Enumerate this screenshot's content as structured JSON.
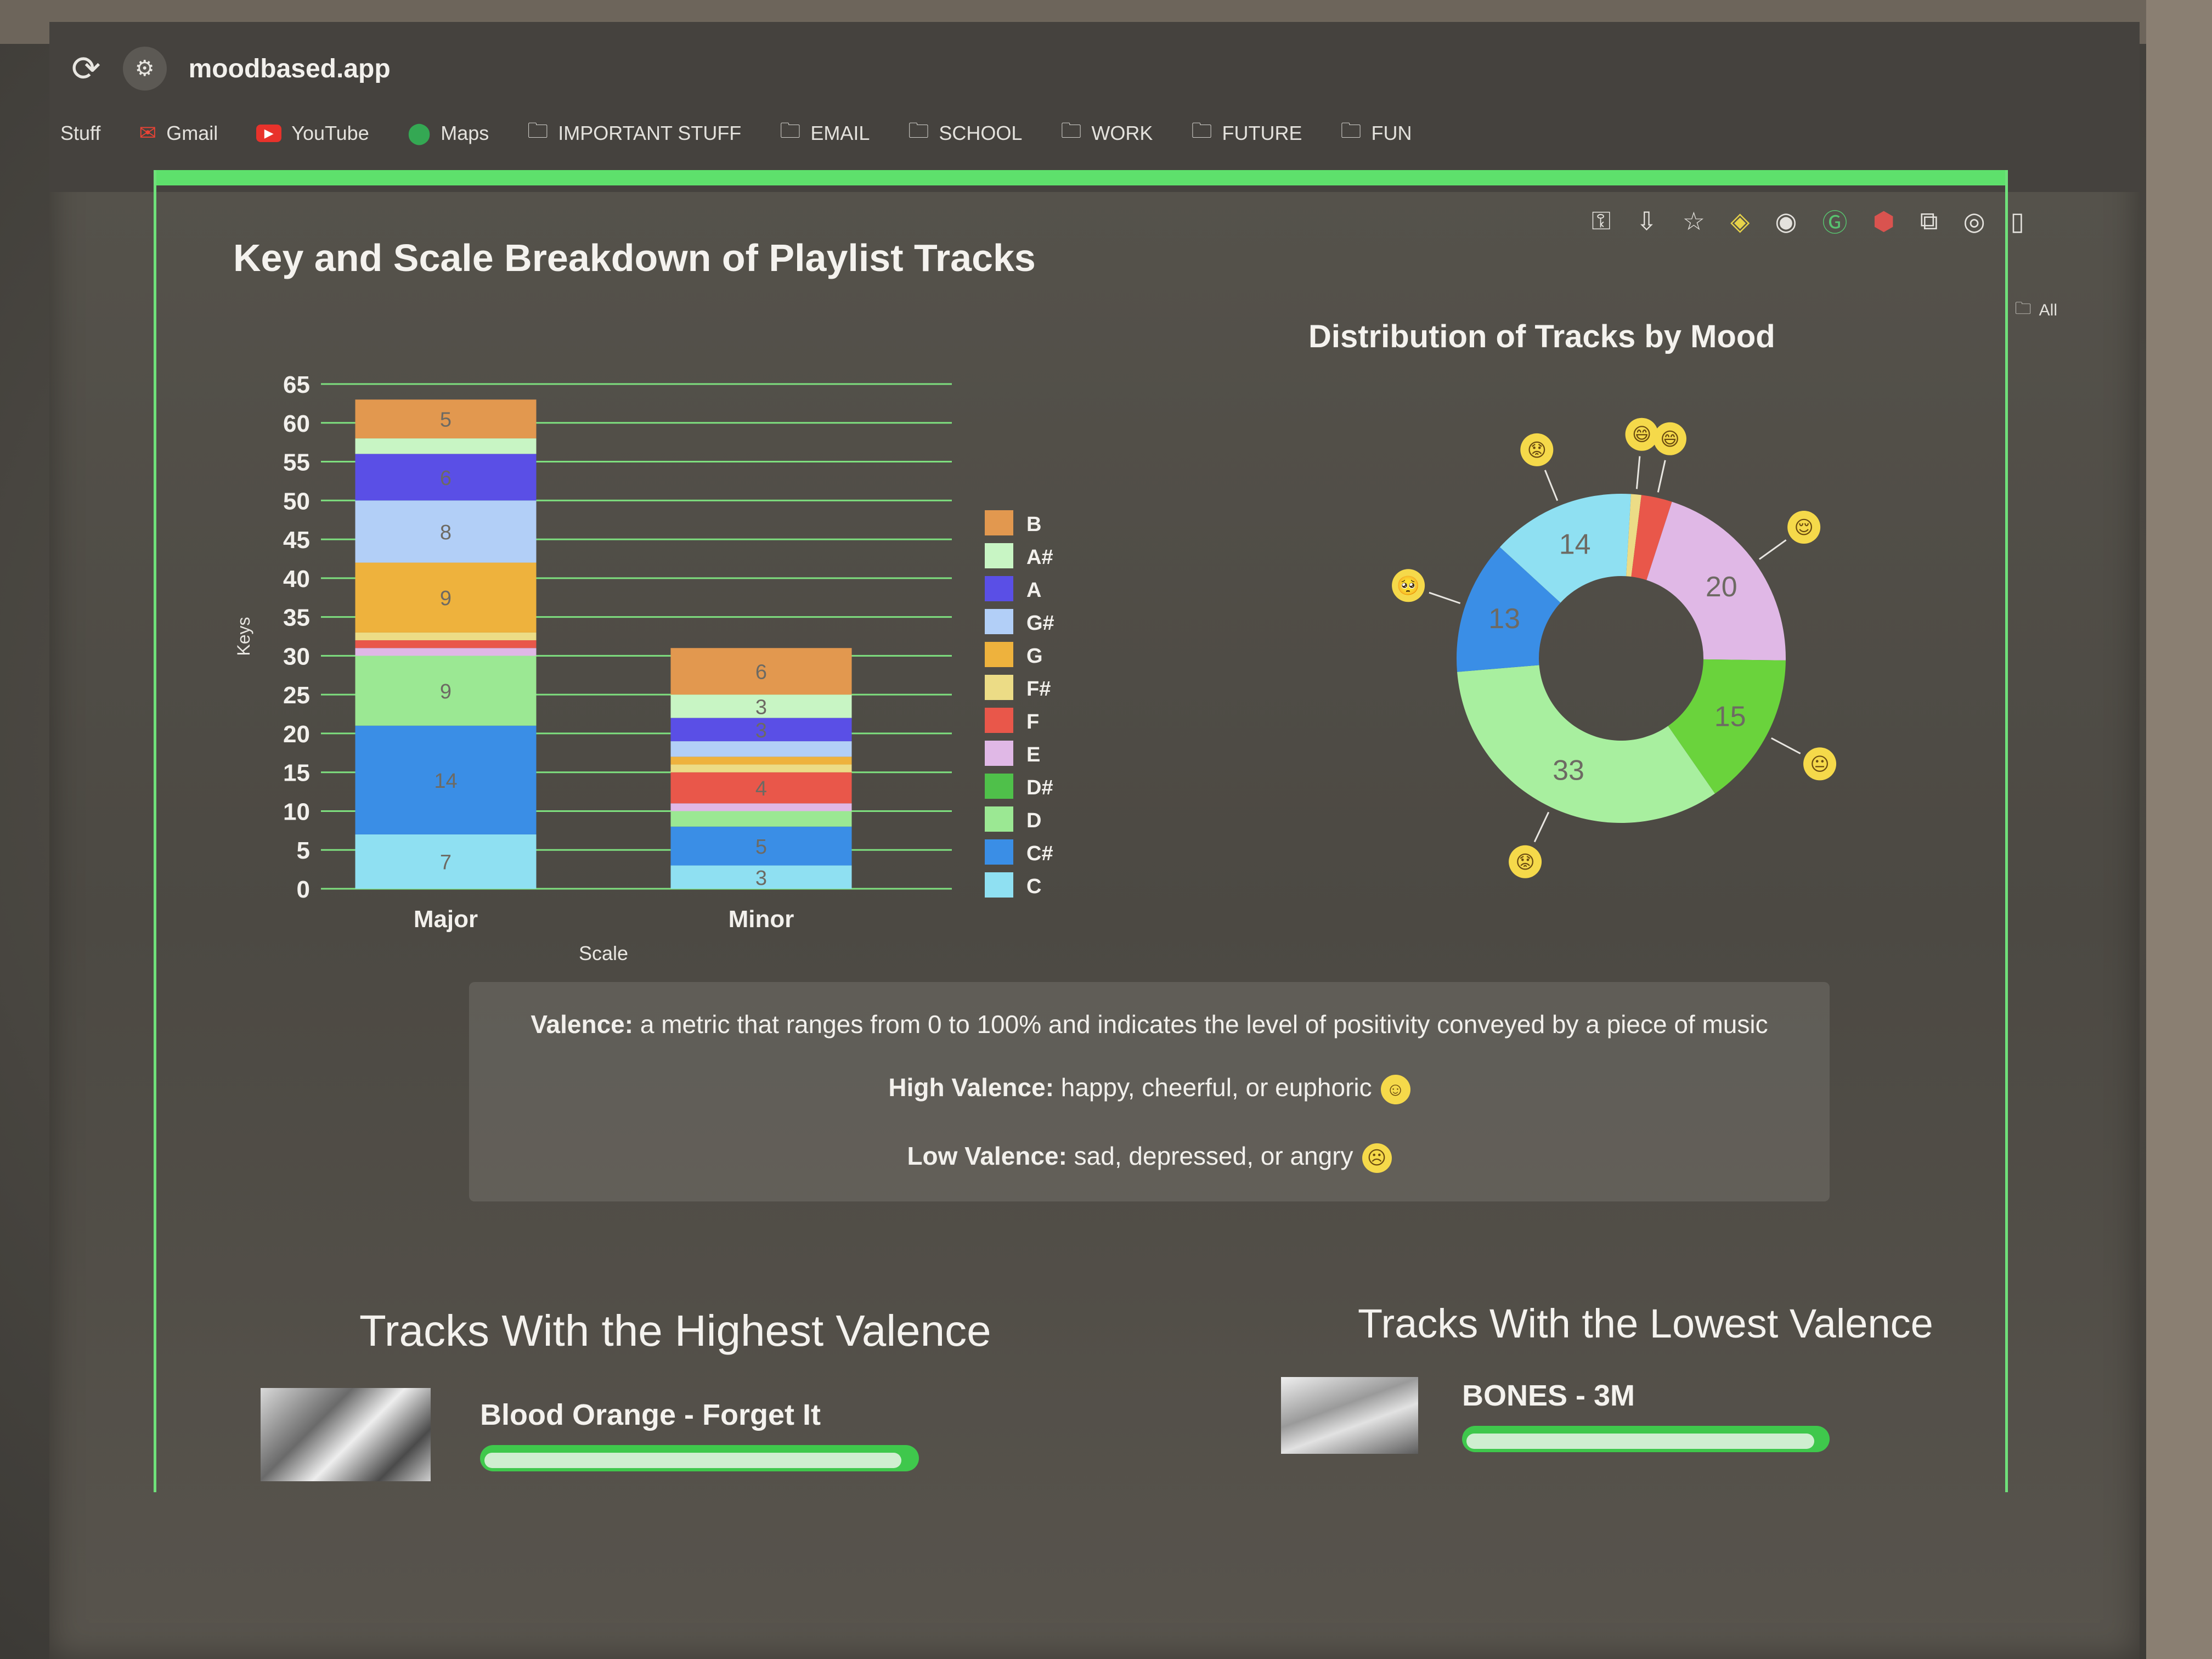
{
  "browser": {
    "url": "moodbased.app",
    "bookmarks": [
      {
        "label": "Stuff",
        "icon": "none"
      },
      {
        "label": "Gmail",
        "icon": "gmail-icon"
      },
      {
        "label": "YouTube",
        "icon": "youtube-icon"
      },
      {
        "label": "Maps",
        "icon": "maps-icon"
      },
      {
        "label": "IMPORTANT STUFF",
        "icon": "folder-icon"
      },
      {
        "label": "EMAIL",
        "icon": "folder-icon"
      },
      {
        "label": "SCHOOL",
        "icon": "folder-icon"
      },
      {
        "label": "WORK",
        "icon": "folder-icon"
      },
      {
        "label": "FUTURE",
        "icon": "folder-icon"
      },
      {
        "label": "FUN",
        "icon": "folder-icon"
      }
    ],
    "all_bookmarks_label": "All"
  },
  "page": {
    "key_chart_title": "Key and Scale Breakdown of Playlist Tracks",
    "mood_chart_title": "Distribution of Tracks by Mood",
    "valence": {
      "definition_label": "Valence:",
      "definition_text": " a metric that ranges from 0 to 100% and indicates the level of positivity conveyed by a piece of music",
      "high_label": "High Valence:",
      "high_text": " happy, cheerful, or euphoric",
      "low_label": "Low Valence:",
      "low_text": " sad, depressed, or angry"
    },
    "highest": {
      "title": "Tracks With the Highest Valence",
      "track": "Blood Orange - Forget It",
      "valence_fill": 0.97
    },
    "lowest": {
      "title": "Tracks With the Lowest Valence",
      "track": "BONES - 3M",
      "valence_fill": 0.97
    }
  },
  "chart_data": [
    {
      "type": "bar",
      "stacked": true,
      "xlabel": "Scale",
      "ylabel": "Keys",
      "ylim": [
        0,
        65
      ],
      "yticks": [
        0,
        5,
        10,
        15,
        20,
        25,
        30,
        35,
        40,
        45,
        50,
        55,
        60,
        65
      ],
      "categories": [
        "Major",
        "Minor"
      ],
      "legend_position": "right",
      "series": [
        {
          "name": "C",
          "color": "#8fe0f2",
          "values": [
            7,
            3
          ]
        },
        {
          "name": "C#",
          "color": "#3a8ee6",
          "values": [
            14,
            5
          ]
        },
        {
          "name": "D",
          "color": "#9be893",
          "values": [
            9,
            2
          ]
        },
        {
          "name": "D#",
          "color": "#4fc04a",
          "values": [
            0,
            0
          ]
        },
        {
          "name": "E",
          "color": "#e0b8e6",
          "values": [
            1,
            1
          ]
        },
        {
          "name": "F",
          "color": "#e9574a",
          "values": [
            1,
            4
          ]
        },
        {
          "name": "F#",
          "color": "#ecdc86",
          "values": [
            1,
            1
          ]
        },
        {
          "name": "G",
          "color": "#eeb23d",
          "values": [
            9,
            1
          ]
        },
        {
          "name": "G#",
          "color": "#b2cff7",
          "values": [
            8,
            2
          ]
        },
        {
          "name": "A",
          "color": "#5a4fe6",
          "values": [
            6,
            3
          ]
        },
        {
          "name": "A#",
          "color": "#c8f5c4",
          "values": [
            2,
            3
          ]
        },
        {
          "name": "B",
          "color": "#e2984f",
          "values": [
            5,
            6
          ]
        }
      ],
      "data_labels": [
        {
          "category": "Major",
          "series": "C",
          "text": "7"
        },
        {
          "category": "Major",
          "series": "C#",
          "text": "14"
        },
        {
          "category": "Major",
          "series": "D",
          "text": "9"
        },
        {
          "category": "Major",
          "series": "G",
          "text": "9"
        },
        {
          "category": "Major",
          "series": "G#",
          "text": "8"
        },
        {
          "category": "Major",
          "series": "A",
          "text": "6"
        },
        {
          "category": "Major",
          "series": "B",
          "text": "5"
        },
        {
          "category": "Minor",
          "series": "C",
          "text": "3"
        },
        {
          "category": "Minor",
          "series": "C#",
          "text": "5"
        },
        {
          "category": "Minor",
          "series": "F",
          "text": "4"
        },
        {
          "category": "Minor",
          "series": "A",
          "text": "3"
        },
        {
          "category": "Minor",
          "series": "A#",
          "text": "3"
        },
        {
          "category": "Minor",
          "series": "B",
          "text": "6"
        }
      ]
    },
    {
      "type": "pie",
      "donut": true,
      "slices": [
        {
          "value": 1,
          "color": "#ecdc86",
          "label": "",
          "emoji": "😄"
        },
        {
          "value": 3,
          "color": "#e9574a",
          "label": "",
          "emoji": "😄"
        },
        {
          "value": 20,
          "color": "#e0b8e6",
          "label": "20",
          "emoji": "😌"
        },
        {
          "value": 15,
          "color": "#6ad33c",
          "label": "15",
          "emoji": "😐"
        },
        {
          "value": 33,
          "color": "#a8ef9f",
          "label": "33",
          "emoji": "😟"
        },
        {
          "value": 13,
          "color": "#3a8ee6",
          "label": "13",
          "emoji": "🥺"
        },
        {
          "value": 14,
          "color": "#8fe0f2",
          "label": "14",
          "emoji": "😟"
        }
      ]
    }
  ]
}
